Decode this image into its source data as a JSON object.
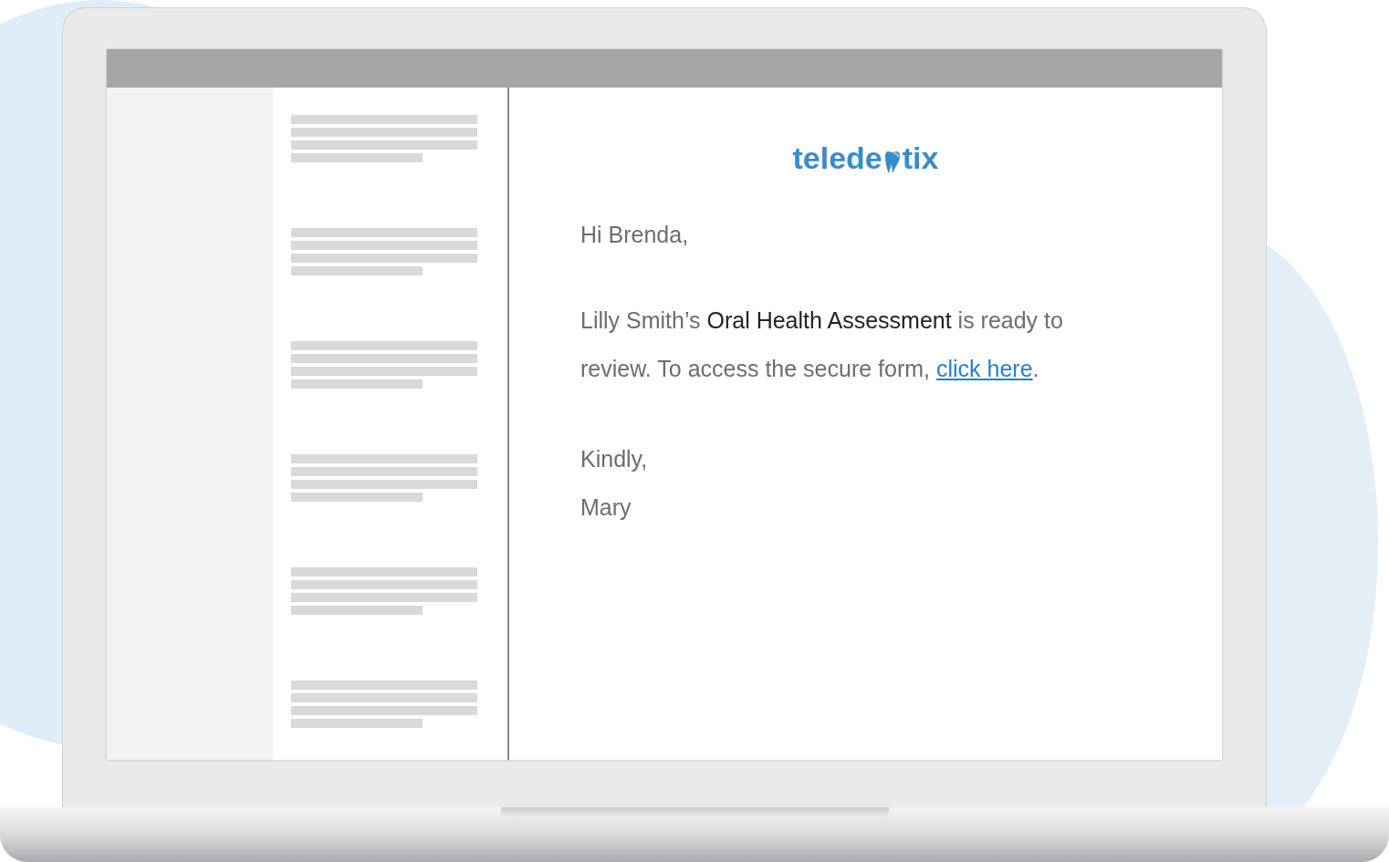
{
  "logo": {
    "before": "telede",
    "after": "tix"
  },
  "previews": [
    {
      "kind": "placeholder"
    },
    {
      "kind": "placeholder"
    },
    {
      "kind": "placeholder"
    },
    {
      "kind": "placeholder"
    },
    {
      "kind": "placeholder"
    },
    {
      "kind": "placeholder"
    }
  ],
  "email": {
    "greeting": "Hi Brenda,",
    "body": "Lilly Smith’s **Oral Health Assessment** is ready to review. To access the secure form, ",
    "link": "click here",
    "body_end": ".",
    "closing": "Kindly,",
    "signature": "Mary"
  }
}
